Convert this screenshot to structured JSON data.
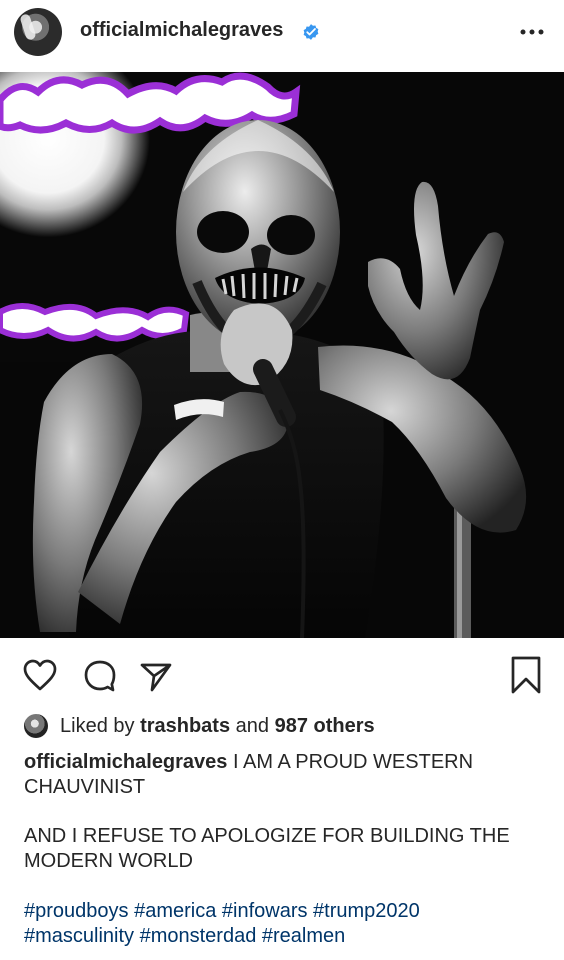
{
  "post": {
    "username": "officialmichalegraves",
    "verified": true,
    "more_icon": "more-dots-icon"
  },
  "actions": {
    "like_icon": "heart-icon",
    "comment_icon": "comment-icon",
    "share_icon": "send-icon",
    "save_icon": "bookmark-icon"
  },
  "likes": {
    "prefix": "Liked by",
    "liker": "trashbats",
    "middle": "and",
    "count": "987 others"
  },
  "caption": {
    "author": "officialmichalegraves",
    "line1": "I AM A PROUD WESTERN",
    "line2": "CHAUVINIST",
    "line3": "AND I REFUSE TO APOLOGIZE FOR BUILDING THE",
    "line4": "MODERN WORLD",
    "hashtags_line1": "#proudboys #america #infowars #trump2020",
    "hashtags_line2": "#masculinity #monsterdad #realmen"
  },
  "colors": {
    "text": "#262626",
    "hashtag": "#003569",
    "verified": "#3897f0",
    "stage_glow": "#9b2fd6"
  }
}
